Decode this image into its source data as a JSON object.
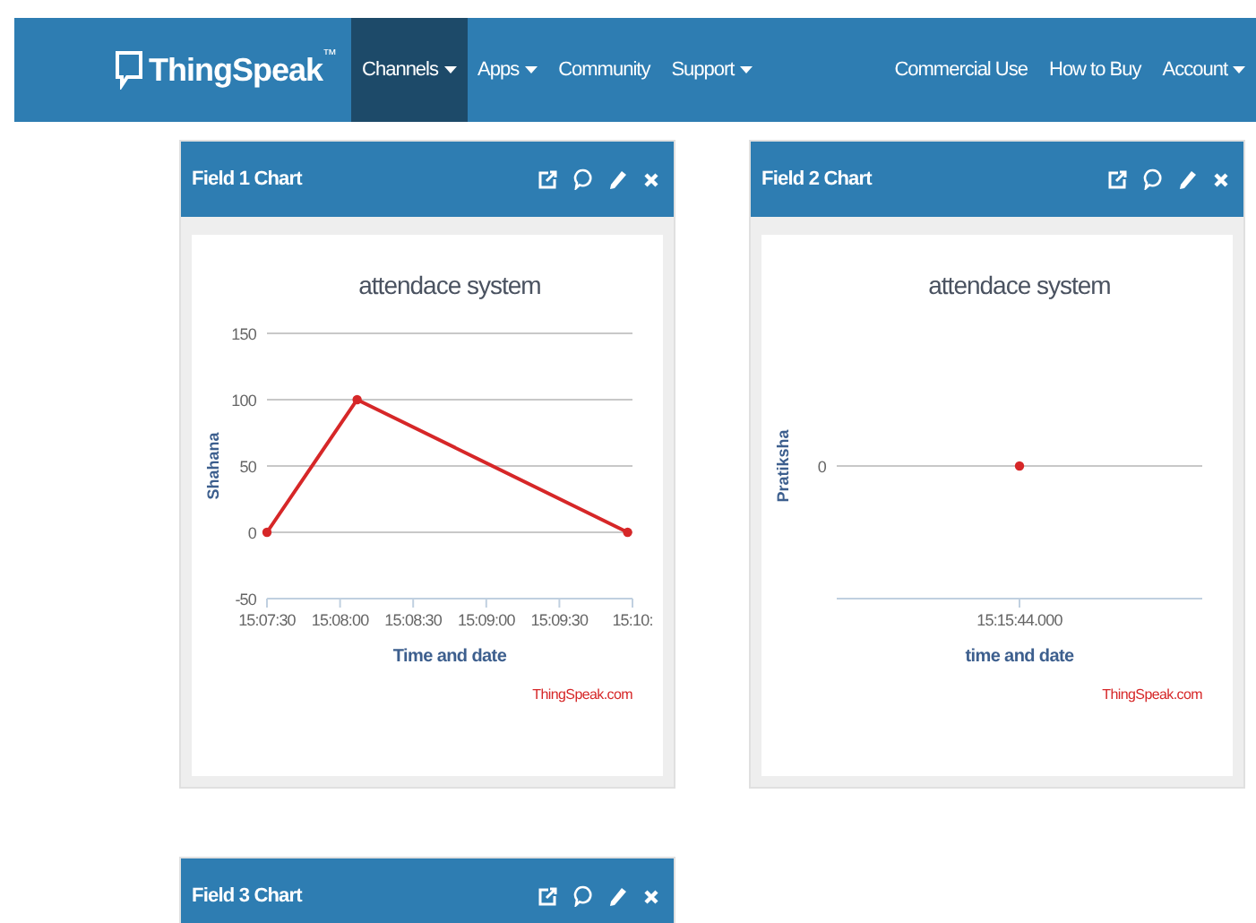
{
  "navbar": {
    "brand": "ThingSpeak",
    "trademark": "™",
    "left_items": [
      {
        "label": "Channels",
        "has_menu": true,
        "selected": true
      },
      {
        "label": "Apps",
        "has_menu": true,
        "selected": false
      },
      {
        "label": "Community",
        "has_menu": false,
        "selected": false
      },
      {
        "label": "Support",
        "has_menu": true,
        "selected": false
      }
    ],
    "right_items": [
      {
        "label": "Commercial Use",
        "has_menu": false,
        "selected": false
      },
      {
        "label": "How to Buy",
        "has_menu": false,
        "selected": false
      },
      {
        "label": "Account",
        "has_menu": true,
        "selected": false
      }
    ]
  },
  "cards": [
    {
      "title": "Field 1 Chart",
      "credit": "ThingSpeak.com",
      "chart_data": {
        "type": "line",
        "title": "attendace system",
        "xlabel": "Time and date",
        "ylabel": "Shahana",
        "grid": true,
        "x": [
          54450,
          54487,
          54598
        ],
        "series": [
          {
            "color": "#d62728",
            "marker": true,
            "values": [
              0,
              100,
              0
            ]
          }
        ],
        "xlim": [
          54450,
          54600
        ],
        "ylim": [
          -50,
          150
        ],
        "yticks": [
          -50,
          0,
          50,
          100,
          150
        ],
        "xticks": [
          {
            "value": 54450,
            "label": "15:07:30"
          },
          {
            "value": 54480,
            "label": "15:08:00"
          },
          {
            "value": 54510,
            "label": "15:08:30"
          },
          {
            "value": 54540,
            "label": "15:09:00"
          },
          {
            "value": 54570,
            "label": "15:09:30"
          },
          {
            "value": 54600,
            "label": "15:10:"
          }
        ]
      }
    },
    {
      "title": "Field 2 Chart",
      "credit": "ThingSpeak.com",
      "plot": {
        "title": "attendace system",
        "xlabel": "time and date",
        "ylabel": "Pratiksha",
        "y_tick_labels": [
          "0"
        ],
        "x_tick_labels": [
          "15:15:44.000"
        ]
      }
    },
    {
      "title": "Field 3 Chart"
    }
  ]
}
